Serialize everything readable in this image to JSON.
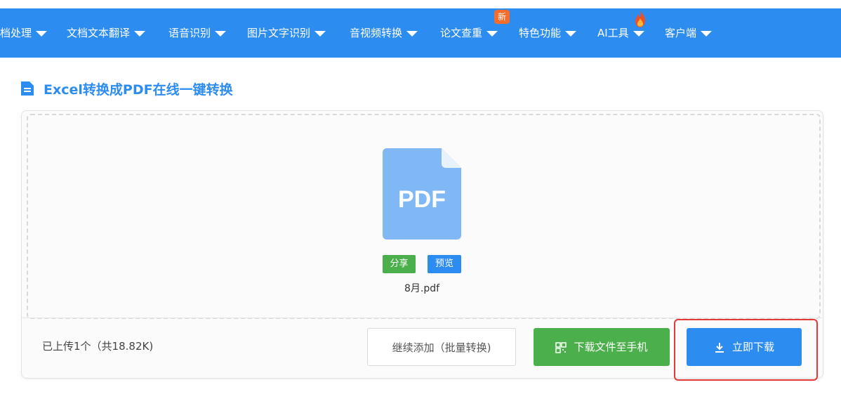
{
  "nav": {
    "items": [
      {
        "label": "档处理"
      },
      {
        "label": "文档文本翻译"
      },
      {
        "label": "语音识别"
      },
      {
        "label": "图片文字识别"
      },
      {
        "label": "音视频转换"
      },
      {
        "label": "论文查重"
      },
      {
        "label": "特色功能"
      },
      {
        "label": "AI工具"
      },
      {
        "label": "客户端"
      }
    ],
    "new_badge": "新"
  },
  "page": {
    "title": "Excel转换成PDF在线一键转换"
  },
  "file": {
    "type_label": "PDF",
    "share_label": "分享",
    "preview_label": "预览",
    "name": "8月.pdf"
  },
  "footer": {
    "status": "已上传1个（共18.82K)",
    "continue_button": "继续添加（批量转换)",
    "phone_button": "下载文件至手机",
    "download_button": "立即下载"
  },
  "colors": {
    "primary": "#2d8cf0",
    "success": "#4bb04b",
    "highlight": "#e53935",
    "badge": "#f56c2d"
  },
  "icons": [
    "chevron-down-icon",
    "fire-icon",
    "document-icon",
    "pdf-file-icon",
    "qr-code-icon",
    "download-icon"
  ]
}
